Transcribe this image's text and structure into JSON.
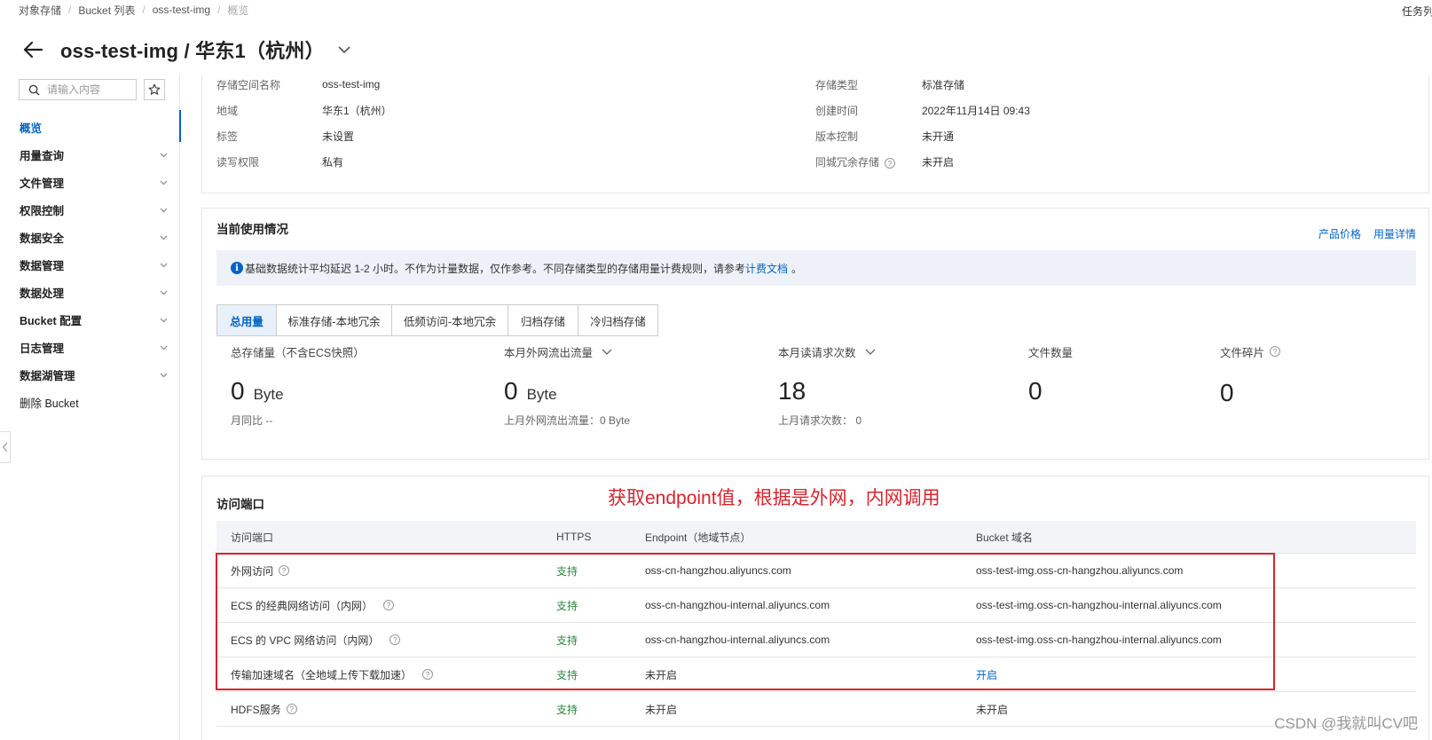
{
  "breadcrumb": [
    "对象存储",
    "Bucket 列表",
    "oss-test-img",
    "概览"
  ],
  "task_link": "任务列表",
  "page": {
    "title": "oss-test-img / 华东1（杭州）"
  },
  "sidebar": {
    "search_placeholder": "请输入内容",
    "items": [
      {
        "label": "概览",
        "active": true
      },
      {
        "label": "用量查询"
      },
      {
        "label": "文件管理"
      },
      {
        "label": "权限控制"
      },
      {
        "label": "数据安全"
      },
      {
        "label": "数据管理"
      },
      {
        "label": "数据处理"
      },
      {
        "label": "Bucket 配置"
      },
      {
        "label": "日志管理"
      },
      {
        "label": "数据湖管理"
      },
      {
        "label": "删除 Bucket"
      }
    ]
  },
  "info": {
    "left": [
      {
        "label": "存储空间名称",
        "value": "oss-test-img"
      },
      {
        "label": "地域",
        "value": "华东1（杭州）"
      },
      {
        "label": "标签",
        "value": "未设置"
      },
      {
        "label": "读写权限",
        "value": "私有"
      }
    ],
    "right": [
      {
        "label": "存储类型",
        "value": "标准存储"
      },
      {
        "label": "创建时间",
        "value": "2022年11月14日 09:43"
      },
      {
        "label": "版本控制",
        "value": "未开通"
      },
      {
        "label": "同城冗余存储",
        "value": "未开启"
      }
    ]
  },
  "usage": {
    "title": "当前使用情况",
    "links": [
      "产品价格",
      "用量详情"
    ],
    "notice_text": "基础数据统计平均延迟 1-2 小时。不作为计量数据，仅作参考。不同存储类型的存储用量计费规则，请参考",
    "notice_link": "计费文档",
    "notice_end": "。",
    "tabs": [
      "总用量",
      "标准存储-本地冗余",
      "低频访问-本地冗余",
      "归档存储",
      "冷归档存储"
    ],
    "stats": [
      {
        "label": "总存储量（不含ECS快照）",
        "value": "0",
        "unit": "Byte",
        "sub": "月同比 --"
      },
      {
        "label": "本月外网流出流量",
        "value": "0",
        "unit": "Byte",
        "sub": "上月外网流出流量：0 Byte"
      },
      {
        "label": "本月读请求次数",
        "value": "18",
        "unit": "",
        "sub": "上月请求次数： 0"
      },
      {
        "label": "文件数量",
        "value": "0",
        "unit": "",
        "sub": ""
      },
      {
        "label": "文件碎片",
        "value": "0",
        "unit": "",
        "sub": ""
      }
    ]
  },
  "endpoint": {
    "title": "访问端口",
    "annotation": "获取endpoint值，根据是外网，内网调用",
    "headers": [
      "访问端口",
      "HTTPS",
      "Endpoint（地域节点）",
      "Bucket 域名"
    ],
    "rows": [
      {
        "name": "外网访问",
        "https": "支持",
        "endpoint": "oss-cn-hangzhou.aliyuncs.com",
        "domain": "oss-test-img.oss-cn-hangzhou.aliyuncs.com"
      },
      {
        "name": "ECS 的经典网络访问（内网）",
        "https": "支持",
        "endpoint": "oss-cn-hangzhou-internal.aliyuncs.com",
        "domain": "oss-test-img.oss-cn-hangzhou-internal.aliyuncs.com"
      },
      {
        "name": "ECS 的 VPC 网络访问（内网）",
        "https": "支持",
        "endpoint": "oss-cn-hangzhou-internal.aliyuncs.com",
        "domain": "oss-test-img.oss-cn-hangzhou-internal.aliyuncs.com"
      },
      {
        "name": "传输加速域名（全地域上传下载加速）",
        "https": "支持",
        "endpoint": "未开启",
        "domain": "开启"
      },
      {
        "name": "HDFS服务",
        "https": "支持",
        "endpoint": "未开启",
        "domain": "未开启"
      }
    ]
  },
  "watermark": "CSDN @我就叫CV吧",
  "colors": {
    "primary": "#0064c8",
    "support_green": "#2a8a3e",
    "annotation_red": "#d9232d"
  }
}
